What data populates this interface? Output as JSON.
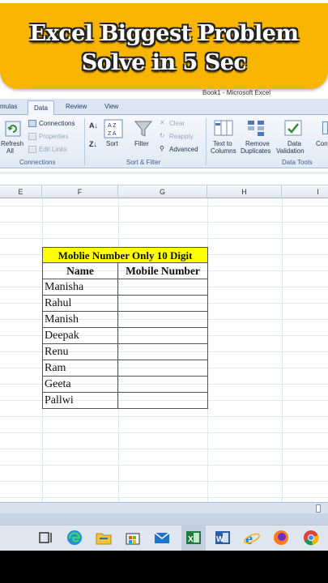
{
  "banner": {
    "line1": "Excel Biggest Problem",
    "line2": "Solve in 5 Sec"
  },
  "window": {
    "title": "Book1 - Microsoft Excel"
  },
  "ribbon": {
    "tabs": [
      "mulas",
      "Data",
      "Review",
      "View"
    ],
    "active_tab": "Data",
    "connections_group": {
      "refresh_label": "Refresh",
      "refresh_sub": "All",
      "connections": "Connections",
      "properties": "Properties",
      "edit_links": "Edit Links",
      "label": "Connections"
    },
    "sort_filter_group": {
      "sort": "Sort",
      "filter": "Filter",
      "clear": "Clear",
      "reapply": "Reapply",
      "advanced": "Advanced",
      "label": "Sort & Filter"
    },
    "data_tools_group": {
      "text_to": "Text to",
      "columns": "Columns",
      "remove": "Remove",
      "duplicates": "Duplicates",
      "data": "Data",
      "validation": "Validation",
      "con": "Con",
      "label": "Data Tools"
    }
  },
  "columns": [
    "E",
    "F",
    "G",
    "H",
    "I"
  ],
  "table": {
    "title": "Moblie Number Only 10 Digit",
    "headers": {
      "name": "Name",
      "mobile": "Mobile Number"
    },
    "rows": [
      "Manisha",
      "Rahul",
      "Manish",
      "Deepak",
      "Renu",
      "Ram",
      "Geeta",
      "Pallwi"
    ]
  },
  "taskbar": {
    "icons": [
      "task-view-icon",
      "edge-icon",
      "file-explorer-icon",
      "store-icon",
      "mail-icon",
      "excel-icon",
      "word-icon",
      "internet-explorer-icon",
      "firefox-icon",
      "chrome-icon"
    ]
  },
  "colors": {
    "banner": "#f7b500",
    "title_fill": "#ffff00",
    "ribbon": "#dbe5f1"
  }
}
